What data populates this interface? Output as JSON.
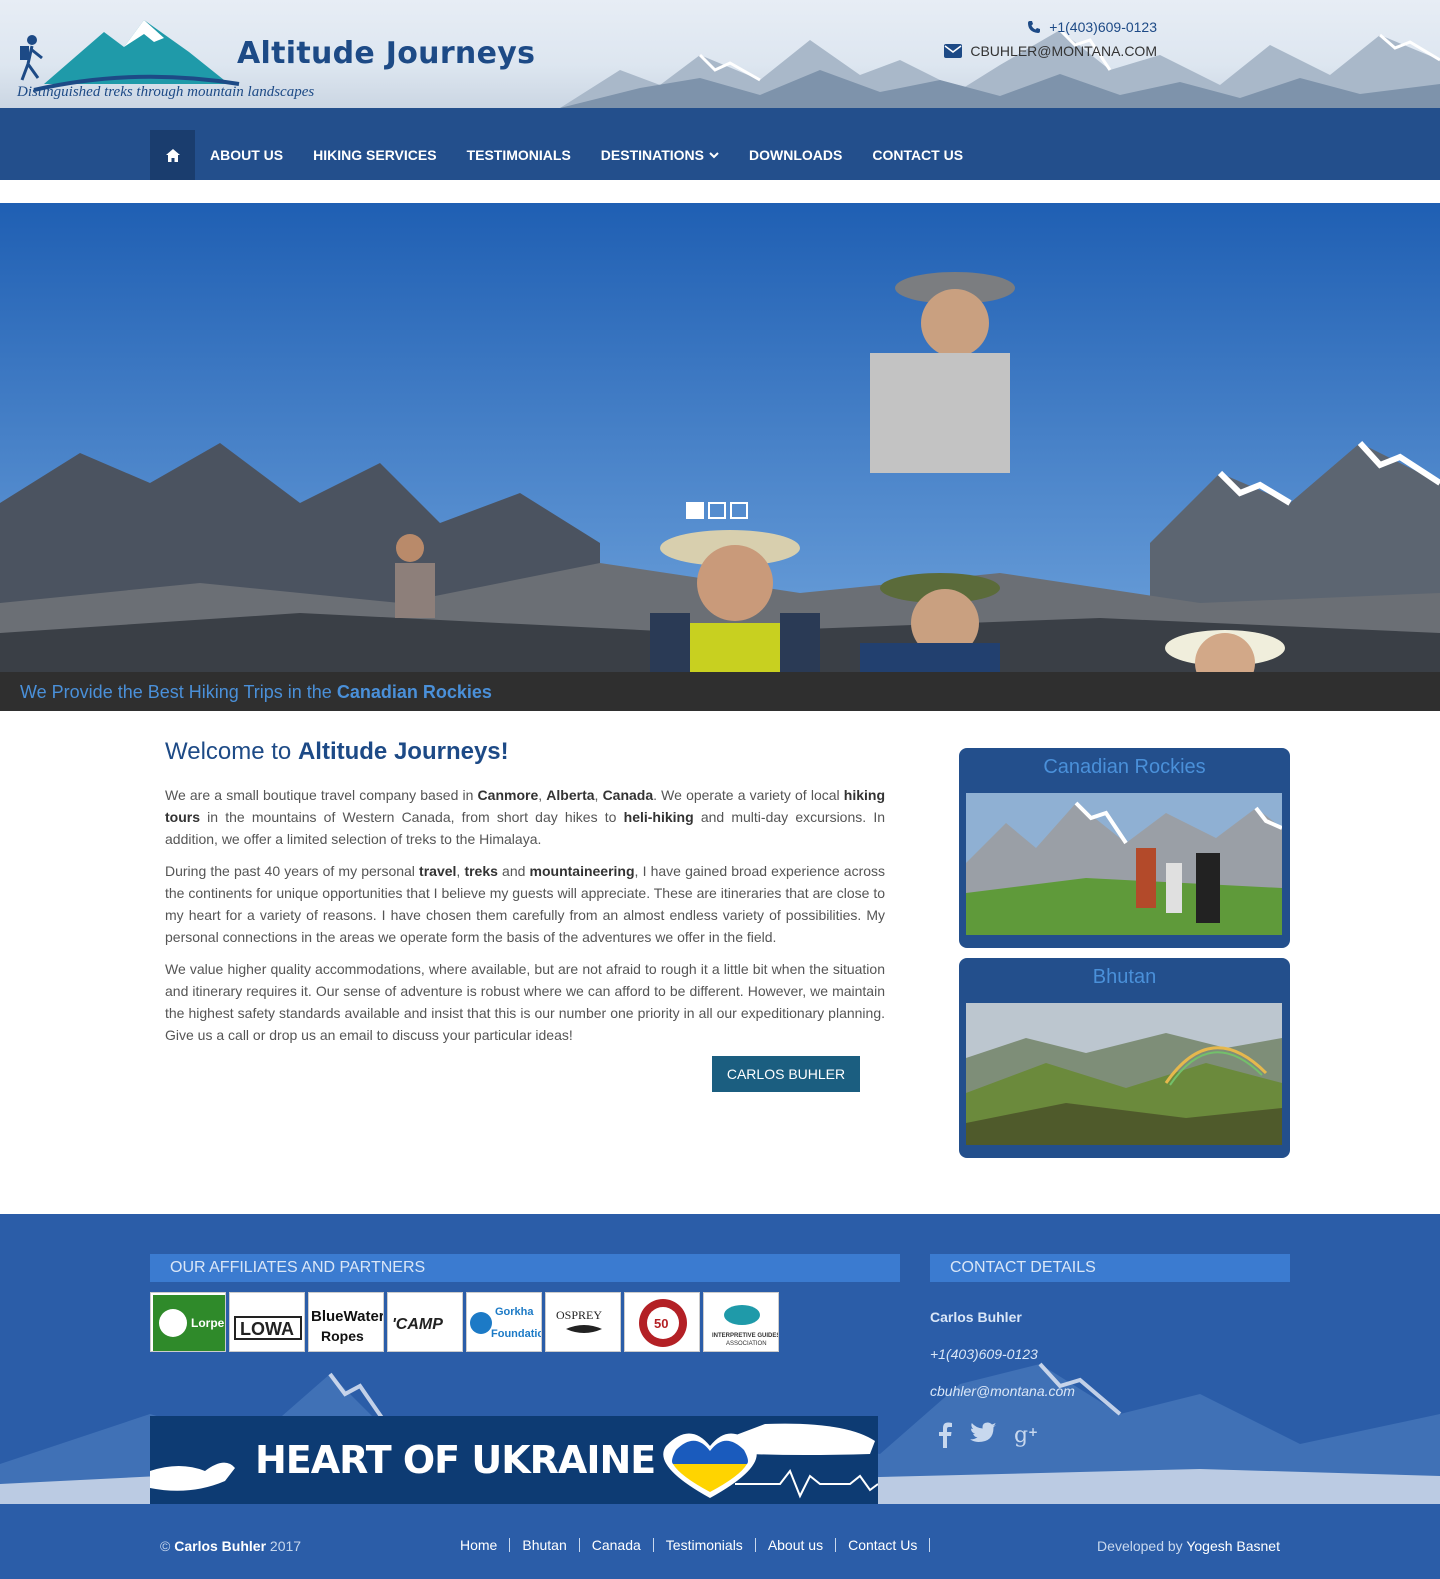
{
  "header": {
    "brand_name": "Altitude Journeys",
    "tagline": "Distinguished treks through mountain landscapes",
    "phone": "+1(403)609-0123",
    "email": "CBUHLER@MONTANA.COM"
  },
  "nav": {
    "items": [
      {
        "label": "About Us"
      },
      {
        "label": "Hiking Services"
      },
      {
        "label": "Testimonials"
      },
      {
        "label": "Destinations"
      },
      {
        "label": "Downloads"
      },
      {
        "label": "Contact Us"
      }
    ]
  },
  "slider": {
    "caption_prefix": "We Provide the Best Hiking Trips in the",
    "caption_highlight": "Canadian Rockies",
    "slide_count": 3,
    "active_slide": 1
  },
  "welcome": {
    "title_prefix": "Welcome to",
    "title_highlight": "Altitude Journeys!",
    "p1": {
      "t1": "We are a small boutique travel company based in ",
      "b1": "Canmore",
      "t2": ", ",
      "b2": "Alberta",
      "t3": ", ",
      "b3": "Canada",
      "t4": ". We operate a variety of local ",
      "b4": "hiking tours",
      "t5": " in the mountains of Western Canada, from short day hikes to ",
      "b5": "heli-hiking",
      "t6": " and multi-day excursions. In addition, we offer a limited selection of treks to the Himalaya."
    },
    "p2": {
      "t1": "During the past 40 years of my personal ",
      "b1": "travel",
      "t2": ", ",
      "b2": "treks",
      "t3": " and ",
      "b3": "mountaineering",
      "t4": ", I have gained broad experience across the continents for unique opportunities that I believe my guests will appreciate. These are itineraries that are close to my heart for a variety of reasons. I have chosen them carefully from an almost endless variety of possibilities. My personal connections in the areas we operate form the basis of the adventures we offer in the field."
    },
    "p3": "We value higher quality accommodations, where available, but are not afraid to rough it a little bit when the situation and itinerary requires it. Our sense of adventure is robust where we can afford to be different. However, we maintain the highest safety standards available and insist that this is our number one priority in all our expeditionary planning. Give us a call or drop us an email to discuss your particular ideas!",
    "signature_button": "Carlos Buhler"
  },
  "sidebar": {
    "boxes": [
      {
        "title": "Canadian Rockies"
      },
      {
        "title": "Bhutan"
      }
    ]
  },
  "footer": {
    "affiliates_title": "Our Affiliates and Partners",
    "affiliates": [
      {
        "name": "Lorpen"
      },
      {
        "name": "LOWA"
      },
      {
        "name": "BlueWater Ropes"
      },
      {
        "name": "CAMP"
      },
      {
        "name": "Gorkha Foundation"
      },
      {
        "name": "OSPREY"
      },
      {
        "name": "Canadian Mountain Guides 50"
      },
      {
        "name": "Interpretive Guides Association"
      }
    ],
    "ukraine_banner": "HEART OF UKRAINE",
    "contact_title": "Contact Details",
    "contact_name": "Carlos Buhler",
    "contact_phone": "+1(403)609-0123",
    "contact_email": "cbuhler@montana.com",
    "social": [
      "facebook-icon",
      "twitter-icon",
      "google-plus-icon"
    ]
  },
  "bottom": {
    "copyright_symbol": "©",
    "copyright_name": "Carlos Buhler",
    "copyright_year": "2017",
    "links": [
      "Home",
      "Bhutan",
      "Canada",
      "Testimonials",
      "About us",
      "Contact Us"
    ],
    "dev_prefix": "Developed by",
    "dev_name": "Yogesh Basnet"
  },
  "colors": {
    "nav_bg": "#234f8c",
    "accent": "#4a90d9",
    "button": "#1b5e80",
    "footer_bg": "#2b5da8"
  }
}
